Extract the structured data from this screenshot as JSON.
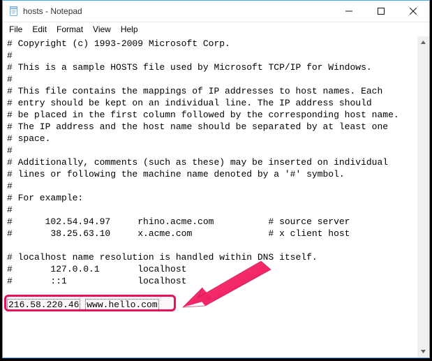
{
  "window": {
    "title": "hosts - Notepad"
  },
  "menu": {
    "items": [
      "File",
      "Edit",
      "Format",
      "View",
      "Help"
    ]
  },
  "editor": {
    "lines": [
      "# Copyright (c) 1993-2009 Microsoft Corp.",
      "#",
      "# This is a sample HOSTS file used by Microsoft TCP/IP for Windows.",
      "#",
      "# This file contains the mappings of IP addresses to host names. Each",
      "# entry should be kept on an individual line. The IP address should",
      "# be placed in the first column followed by the corresponding host name.",
      "# The IP address and the host name should be separated by at least one",
      "# space.",
      "#",
      "# Additionally, comments (such as these) may be inserted on individual",
      "# lines or following the machine name denoted by a '#' symbol.",
      "#",
      "# For example:",
      "#",
      "#      102.54.94.97     rhino.acme.com          # source server",
      "#       38.25.63.10     x.acme.com              # x client host",
      "",
      "# localhost name resolution is handled within DNS itself.",
      "#       127.0.0.1       localhost",
      "#       ::1             localhost",
      ""
    ],
    "added_entry": {
      "ip": "216.58.220.46",
      "host": "www.hello.com"
    }
  },
  "icons": {
    "notepad": "notepad-icon",
    "minimize": "minimize-icon",
    "maximize": "maximize-icon",
    "close": "close-icon"
  }
}
